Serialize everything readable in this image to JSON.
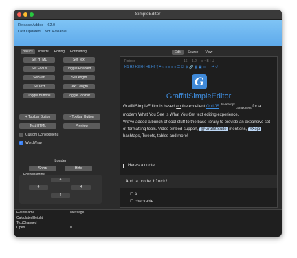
{
  "window": {
    "title": "SimpleEditor",
    "traffic_colors": {
      "close": "#ff5f57",
      "minimize": "#febc2e",
      "maximize": "#28c840"
    }
  },
  "info": {
    "release_label": "Release Added",
    "release_value": "62.0",
    "last_updated_label": "Last Updated",
    "last_updated_value": "Not Available"
  },
  "left_tabs": [
    "Basics",
    "Inserts",
    "Editing",
    "Formatting"
  ],
  "selected_left_tab": "Basics",
  "buttons": {
    "set_html": "Set HTML",
    "set_text": "Set Text",
    "set_focus": "Set Focus",
    "toggle_enabled": "Toggle Enabled",
    "sel_start": "SelStart",
    "sel_length": "SelLength",
    "sel_text": "SelText",
    "text_length": "Text Length",
    "toggle_buttons": "Toggle Buttons",
    "toggle_toolbar": "Toggle Toolbar",
    "add_toolbar_button": "+ Toolbar Button",
    "remove_toolbar_button": "- Toolbar Button",
    "test_html": "Test HTML",
    "preview": "Preview",
    "show": "Show",
    "hide": "Hide"
  },
  "checkboxes": {
    "custom_context_menu": {
      "label": "Custom ContextMenu",
      "checked": false
    },
    "word_wrap": {
      "label": "WordWrap",
      "checked": true,
      "mark": "✓"
    }
  },
  "loader_label": "Loader",
  "editor_margins": {
    "label": "EditorMargins",
    "top": "4",
    "left": "4",
    "right": "4",
    "bottom": "4"
  },
  "editor_tabs": [
    "Edit",
    "Source",
    "View"
  ],
  "selected_editor_tab": "Edit",
  "toolbar": {
    "font": "Roboto",
    "font_size": "16",
    "line_height": "1.2",
    "row1_icons": "≡  •  B  I  U",
    "row2": "H1  H2  H3  H4  H5  H6  ¶  ❝  ‹›  ≡  ≡  ≡  ≡  ☰  ☑  ⊕  🔗  ▦  ▣  ▭  —  ⇄  ↺"
  },
  "editor": {
    "logo_letter": "G",
    "heading": "GraffitiSimpleEditor",
    "p1_a": "GraffitiSimpleEditor is based ",
    "p1_on": "on",
    "p1_the": " the excellent ",
    "p1_link": "QuillJS",
    "p1_sup": "JavaScript",
    "p1_sub": "component",
    "p1_b": " for a modern What You See Is What You Get text editing experience.",
    "p2_a": "We've added a bunch of cool stuff to the base library to provide an expansive set of formatting tools. Video embed support, ",
    "p2_pill1": "@GraffitiSuite",
    "p2_b": " mentions, ",
    "p2_pill2": "#Xojo",
    "p2_c": " hashtags, Tweets, tables and more!",
    "quote": "Here's a quote!",
    "code": "And a code block!",
    "list_item_1": "A",
    "list_item_2": "checkable",
    "list_bullet": "☐"
  },
  "log": {
    "columns": [
      "EventName",
      "Message"
    ],
    "rows": [
      [
        "CalculatedHeight",
        ""
      ],
      [
        "TextChanged",
        ""
      ],
      [
        "Open",
        "0"
      ]
    ]
  }
}
